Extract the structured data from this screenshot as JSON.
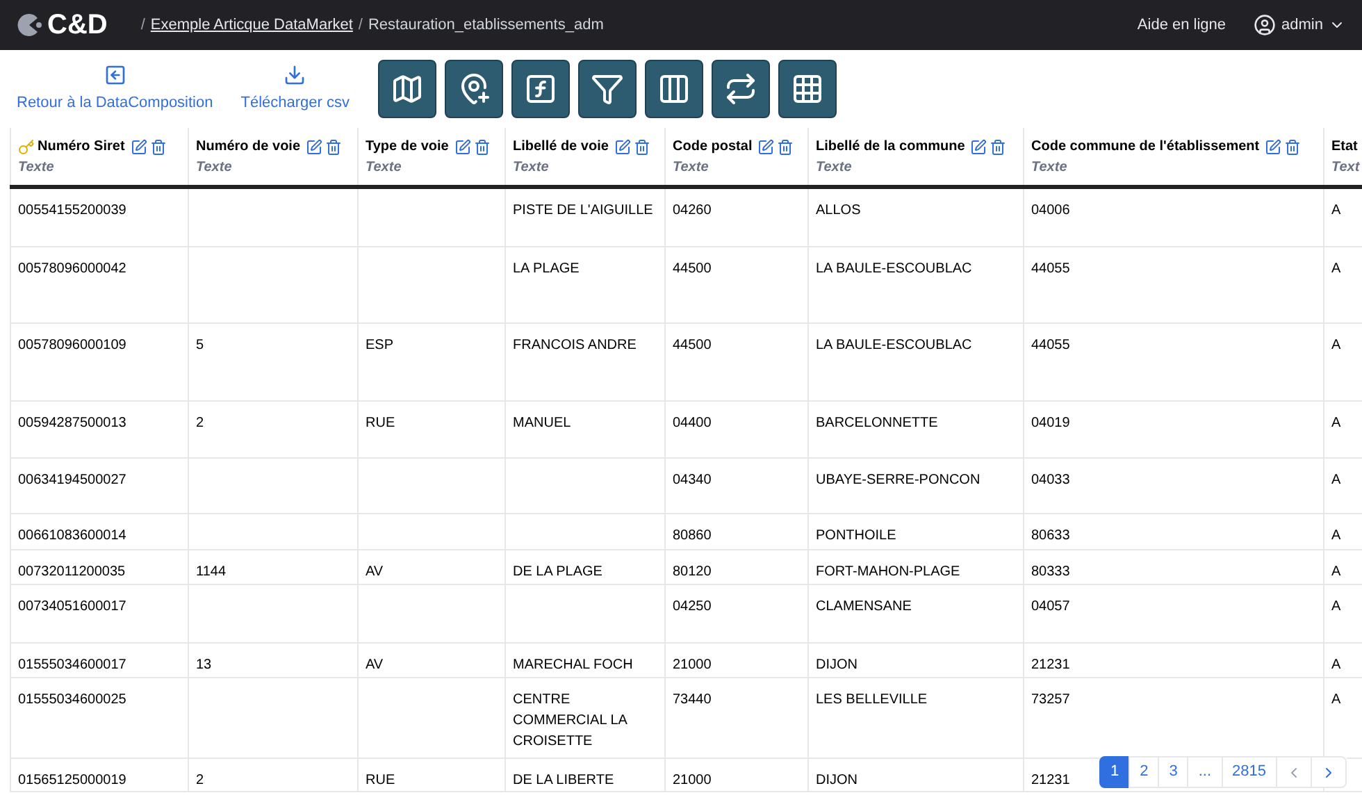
{
  "header": {
    "logo": "C&D",
    "separator": "/",
    "breadcrumb": [
      {
        "label": "Exemple Articque DataMarket",
        "link": true
      },
      {
        "label": "Restauration_etablissements_adm",
        "link": false
      }
    ],
    "help": "Aide en ligne",
    "user": "admin"
  },
  "toolbar": {
    "links": [
      {
        "kind": "back",
        "label": "Retour à la DataComposition"
      },
      {
        "kind": "download",
        "label": "Télécharger csv"
      }
    ],
    "tools": [
      {
        "kind": "map"
      },
      {
        "kind": "pin"
      },
      {
        "kind": "formula"
      },
      {
        "kind": "filter"
      },
      {
        "kind": "columns"
      },
      {
        "kind": "swap"
      },
      {
        "kind": "join"
      }
    ]
  },
  "table": {
    "columns": [
      {
        "name": "Numéro Siret",
        "type": "Texte",
        "key": true,
        "actions": true
      },
      {
        "name": "Numéro de voie",
        "type": "Texte",
        "key": false,
        "actions": true
      },
      {
        "name": "Type de voie",
        "type": "Texte",
        "key": false,
        "actions": true
      },
      {
        "name": "Libellé de voie",
        "type": "Texte",
        "key": false,
        "actions": true
      },
      {
        "name": "Code postal",
        "type": "Texte",
        "key": false,
        "actions": true
      },
      {
        "name": "Libellé de la commune",
        "type": "Texte",
        "key": false,
        "actions": true
      },
      {
        "name": "Code commune de l'établissement",
        "type": "Texte",
        "key": false,
        "actions": true
      },
      {
        "name": "Etat",
        "type": "Text",
        "key": false
      }
    ],
    "rows": [
      [
        "00554155200039",
        "",
        "",
        "PISTE DE L'AIGUILLE",
        "04260",
        "ALLOS",
        "04006",
        "A"
      ],
      [
        "00578096000042",
        "",
        "",
        "LA PLAGE",
        "44500",
        "LA BAULE-ESCOUBLAC",
        "44055",
        "A"
      ],
      [
        "00578096000109",
        "5",
        "ESP",
        "FRANCOIS ANDRE",
        "44500",
        "LA BAULE-ESCOUBLAC",
        "44055",
        "A"
      ],
      [
        "00594287500013",
        "2",
        "RUE",
        "MANUEL",
        "04400",
        "BARCELONNETTE",
        "04019",
        "A"
      ],
      [
        "00634194500027",
        "",
        "",
        "",
        "04340",
        "UBAYE-SERRE-PONCON",
        "04033",
        "A"
      ],
      [
        "00661083600014",
        "",
        "",
        "",
        "80860",
        "PONTHOILE",
        "80633",
        "A"
      ],
      [
        "00732011200035",
        "1144",
        "AV",
        "DE LA PLAGE",
        "80120",
        "FORT-MAHON-PLAGE",
        "80333",
        "A"
      ],
      [
        "00734051600017",
        "",
        "",
        "",
        "04250",
        "CLAMENSANE",
        "04057",
        "A"
      ],
      [
        "01555034600017",
        "13",
        "AV",
        "MARECHAL FOCH",
        "21000",
        "DIJON",
        "21231",
        "A"
      ],
      [
        "01555034600025",
        "",
        "",
        "CENTRE COMMERCIAL LA CROISETTE",
        "73440",
        "LES BELLEVILLE",
        "73257",
        "A"
      ],
      [
        "01565125000019",
        "2",
        "RUE",
        "DE LA LIBERTE",
        "21000",
        "DIJON",
        "21231"
      ]
    ]
  },
  "pagination": {
    "pages": [
      {
        "label": "1",
        "selected": true
      },
      {
        "label": "2",
        "selected": false
      },
      {
        "label": "3",
        "selected": false
      },
      {
        "label": "...",
        "selected": false
      },
      {
        "label": "2815",
        "selected": false
      }
    ]
  }
}
